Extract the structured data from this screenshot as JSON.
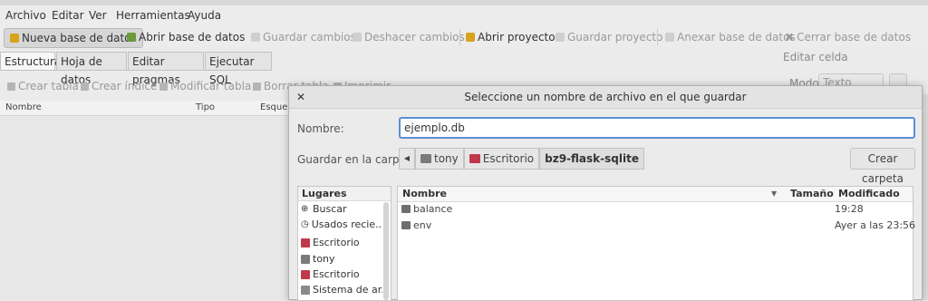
{
  "menubar": {
    "items": [
      {
        "label": "Archivo"
      },
      {
        "label": "Editar"
      },
      {
        "label": "Ver"
      },
      {
        "label": "Herramientas"
      },
      {
        "label": "Ayuda"
      }
    ]
  },
  "toolbar": {
    "new_db": "Nueva base de datos",
    "open_db": "Abrir base de datos",
    "save_changes": "Guardar cambios",
    "undo_changes": "Deshacer cambios",
    "open_project": "Abrir proyecto",
    "save_project": "Guardar proyecto",
    "attach_db": "Anexar base de datos",
    "close_db": "Cerrar base de datos"
  },
  "tabs": [
    {
      "label": "Estructura"
    },
    {
      "label": "Hoja de datos"
    },
    {
      "label": "Editar pragmas"
    },
    {
      "label": "Ejecutar SQL"
    }
  ],
  "edit_cell": {
    "title": "Editar celda",
    "mode_label": "Modo:",
    "mode_value": "Texto"
  },
  "structure_toolbar": {
    "create_table": "Crear tabla",
    "create_index": "Crear índice",
    "modify_table": "Modificar tabla",
    "delete_table": "Borrar tabla",
    "print": "Imprimir"
  },
  "tree_columns": {
    "name": "Nombre",
    "type": "Tipo",
    "schema": "Esquema"
  },
  "dialog": {
    "title": "Seleccione un nombre de archivo en el que guardar",
    "name_label": "Nombre:",
    "name_value": "ejemplo.db",
    "folder_label": "Guardar en la carpeta:",
    "path": [
      {
        "label": "tony",
        "color": "#7a7a7a"
      },
      {
        "label": "Escritorio",
        "color": "#c0394b"
      },
      {
        "label": "bz9-flask-sqlite"
      }
    ],
    "new_folder": "Crear carpeta",
    "places_header": "Lugares",
    "places": [
      {
        "label": "Buscar",
        "icon": "search-icon"
      },
      {
        "label": "Usados recie...",
        "icon": "clock-icon"
      },
      {
        "label": "Escritorio",
        "icon": "desktop-icon",
        "color": "#c0394b"
      },
      {
        "label": "tony",
        "icon": "home-folder-icon",
        "color": "#7a7a7a"
      },
      {
        "label": "Escritorio",
        "icon": "desktop-icon",
        "color": "#c0394b"
      },
      {
        "label": "Sistema de ar...",
        "icon": "drive-icon",
        "color": "#8a8a8a"
      }
    ],
    "columns": {
      "name": "Nombre",
      "size": "Tamaño",
      "modified": "Modificado"
    },
    "files": [
      {
        "name": "balance",
        "modified": "19:28"
      },
      {
        "name": "env",
        "modified": "Ayer a las 23:56"
      }
    ]
  }
}
